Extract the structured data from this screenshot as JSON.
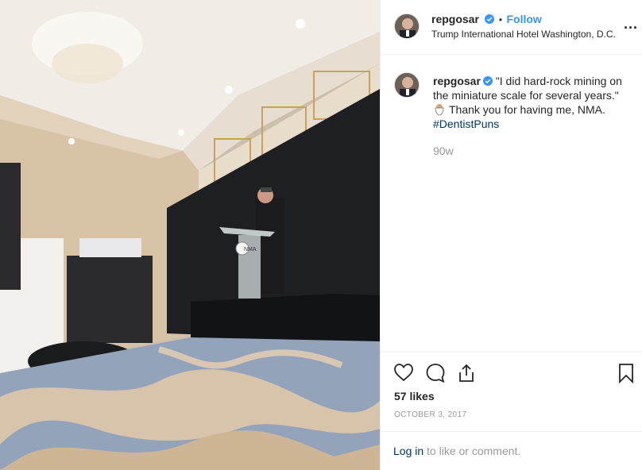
{
  "post": {
    "username": "repgosar",
    "separator": "•",
    "follow_label": "Follow",
    "location": "Trump International Hotel Washington, D.C.",
    "more_icon": "more-options-icon",
    "more_glyph": "...",
    "caption": {
      "text_line1": "\"I did hard-rock mining on",
      "text_line2": "the miniature scale for several years.\"",
      "text_line3": "Thank you for having me, NMA.",
      "hashtag": "#DentistPuns"
    },
    "age": "90w",
    "likes": "57 likes",
    "date": "OCTOBER 3, 2017",
    "login_link": "Log in",
    "login_rest": "to like or comment.",
    "photo_sign_text": "NMA"
  },
  "colors": {
    "accent": "#3897f0",
    "hashtag": "#003569",
    "muted": "#999999",
    "text": "#262626"
  },
  "icons": [
    "verified-badge-icon",
    "heart-icon",
    "comment-icon",
    "share-icon",
    "bookmark-icon",
    "tooth-emoji-icon"
  ]
}
